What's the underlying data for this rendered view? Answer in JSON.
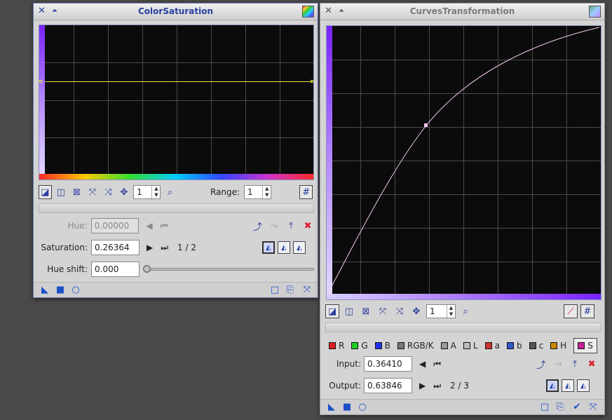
{
  "cs": {
    "title": "ColorSaturation",
    "zoom": "1",
    "range_label": "Range:",
    "range_value": "1",
    "hue_label": "Hue:",
    "hue_value": "0.00000",
    "saturation_label": "Saturation:",
    "saturation_value": "0.26364",
    "point_index": "1 / 2",
    "hueshift_label": "Hue shift:",
    "hueshift_value": "0.000"
  },
  "ct": {
    "title": "CurvesTransformation",
    "zoom": "1",
    "channels": [
      {
        "label": "R",
        "color": "#e02020"
      },
      {
        "label": "G",
        "color": "#22cc22"
      },
      {
        "label": "B",
        "color": "#2233ee"
      },
      {
        "label": "RGB/K",
        "color": "#777777"
      },
      {
        "label": "A",
        "color": "#999999"
      },
      {
        "label": "L",
        "color": "#bbbbbb"
      },
      {
        "label": "a",
        "color": "#cc3333"
      },
      {
        "label": "b",
        "color": "#3355cc"
      },
      {
        "label": "c",
        "color": "#555555"
      },
      {
        "label": "H",
        "color": "#cc8800"
      },
      {
        "label": "S",
        "color": "#cc2299"
      }
    ],
    "selected_channel": "S",
    "input_label": "Input:",
    "input_value": "0.36410",
    "output_label": "Output:",
    "output_value": "0.63846",
    "point_index": "2 / 3"
  },
  "colors": {
    "title_accent": "#283fa0",
    "curve_yellow": "#e8e040",
    "curve_pink": "#f2c8f2",
    "graph_bg": "#0b0b0b"
  },
  "icons": [
    "close-icon",
    "shade-icon",
    "process-icon",
    "edit-point-icon",
    "select-point-icon",
    "delete-point-icon",
    "zoom-fit-icon",
    "zoom-extents-icon",
    "pan-icon",
    "zoom-icon",
    "grid-icon",
    "invert-icon",
    "mirror-icon",
    "reset-icon",
    "apply-global-icon",
    "new-instance-icon",
    "preview-icon",
    "apply-icon",
    "tool-icon"
  ]
}
